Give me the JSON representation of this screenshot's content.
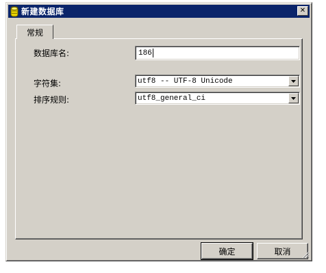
{
  "window": {
    "title": "新建数据库",
    "close_glyph": "✕"
  },
  "tabs": [
    {
      "label": "常规"
    }
  ],
  "form": {
    "db_name_label": "数据库名:",
    "db_name_value": "186",
    "charset_label": "字符集:",
    "charset_value": "utf8 -- UTF-8 Unicode",
    "collation_label": "排序规则:",
    "collation_value": "utf8_general_ci"
  },
  "buttons": {
    "ok": "确定",
    "cancel": "取消"
  },
  "colors": {
    "titlebar": "#0a246a",
    "face": "#d4d0c8"
  },
  "icons": {
    "title": "database-icon",
    "dropdown": "chevron-down-icon"
  }
}
